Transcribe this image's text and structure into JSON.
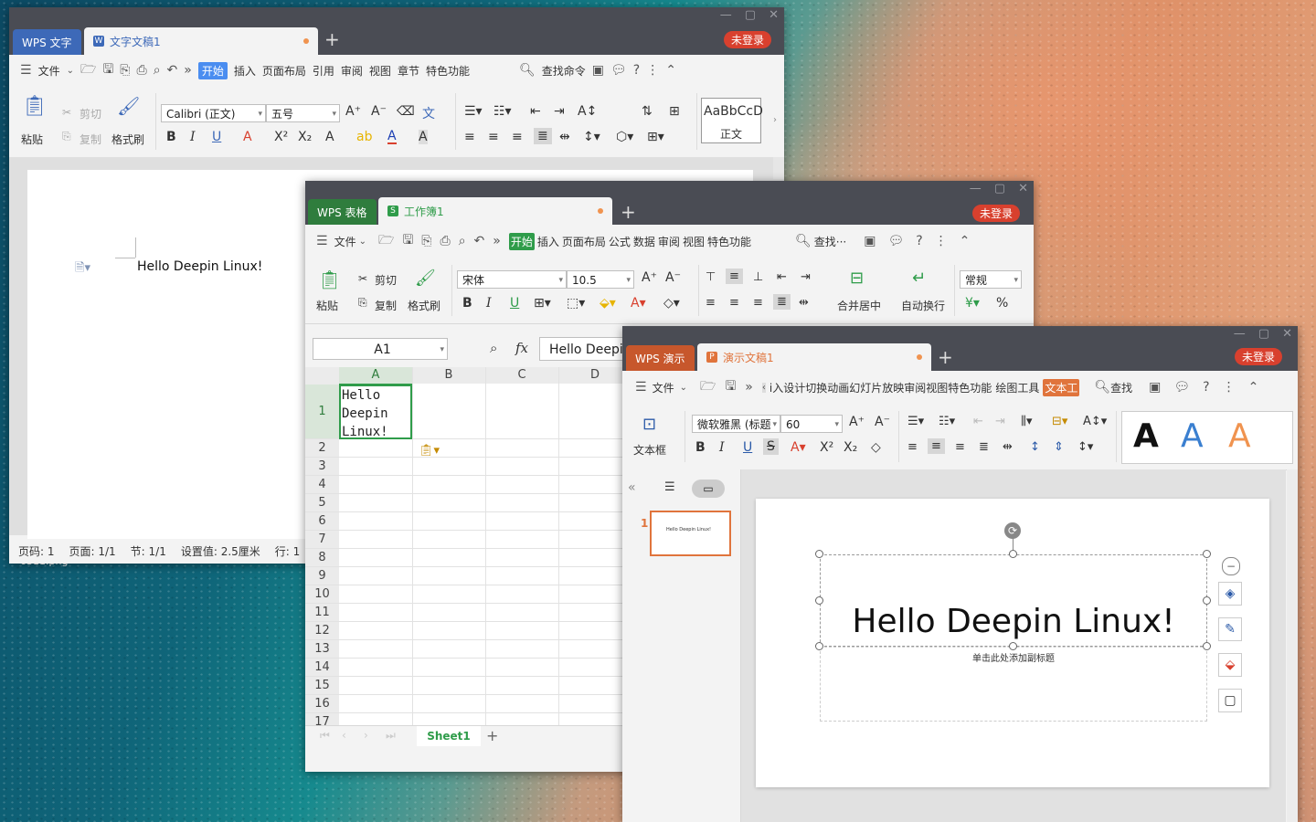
{
  "desktop": {
    "file_label": "6311.png"
  },
  "writer": {
    "app_tab": "WPS 文字",
    "doc_tab": "文字文稿1",
    "login": "未登录",
    "menu": {
      "file": "文件",
      "tabs": [
        "开始",
        "插入",
        "页面布局",
        "引用",
        "审阅",
        "视图",
        "章节",
        "特色功能"
      ],
      "search": "查找命令"
    },
    "ribbon": {
      "paste": "粘贴",
      "cut": "剪切",
      "copy": "复制",
      "format_painter": "格式刷",
      "font": "Calibri (正文)",
      "size": "五号",
      "style_preview": "AaBbCcD",
      "style_name": "正文"
    },
    "body_text": "Hello Deepin Linux!",
    "status": [
      "页码: 1",
      "页面: 1/1",
      "节: 1/1",
      "设置值: 2.5厘米",
      "行: 1"
    ]
  },
  "sheet": {
    "app_tab": "WPS 表格",
    "doc_tab": "工作簿1",
    "login": "未登录",
    "menu": {
      "file": "文件",
      "tabs": [
        "开始",
        "插入",
        "页面布局",
        "公式",
        "数据",
        "审阅",
        "视图",
        "特色功能"
      ],
      "search": "查找···"
    },
    "ribbon": {
      "paste": "粘贴",
      "cut": "剪切",
      "copy": "复制",
      "format_painter": "格式刷",
      "font": "宋体",
      "size": "10.5",
      "merge": "合并居中",
      "wrap": "自动换行",
      "number_format": "常规"
    },
    "name_box": "A1",
    "fx": "fx",
    "formula": "Hello Deepi",
    "columns": [
      "A",
      "B",
      "C",
      "D"
    ],
    "rows": [
      "1",
      "2",
      "3",
      "4",
      "5",
      "6",
      "7",
      "8",
      "9",
      "10",
      "11",
      "12",
      "13",
      "14",
      "15",
      "16",
      "17"
    ],
    "cell_a1": [
      "Hello",
      "Deepin",
      "Linux!"
    ],
    "sheet_tab": "Sheet1"
  },
  "slides": {
    "app_tab": "WPS 演示",
    "doc_tab": "演示文稿1",
    "login": "未登录",
    "menu": {
      "file": "文件",
      "tabs": [
        "i入",
        "设计",
        "切换",
        "动画",
        "幻灯片放映",
        "审阅",
        "视图",
        "特色功能",
        "绘图工具",
        "文本工"
      ],
      "search": "查找"
    },
    "ribbon": {
      "textbox": "文本框",
      "font": "微软雅黑 (标题",
      "size": "60",
      "art": [
        "A",
        "A",
        "A"
      ]
    },
    "thumb_num": "1",
    "thumb_text": "Hello Deepin Linux!",
    "title_text": "Hello Deepin Linux!",
    "subtitle_hint": "单击此处添加副标题"
  }
}
